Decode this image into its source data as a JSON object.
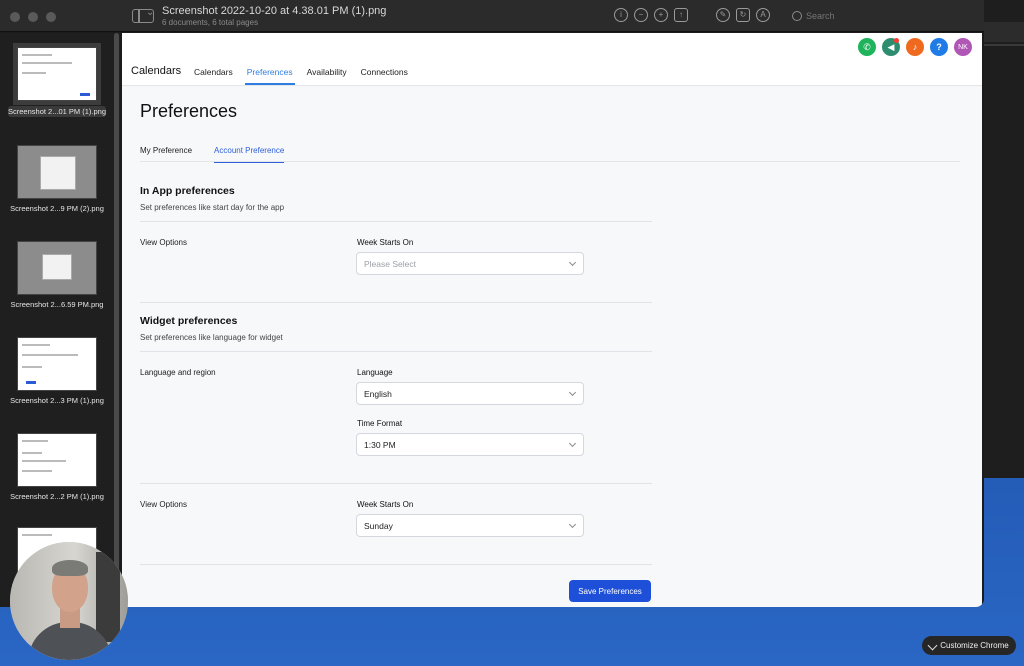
{
  "window": {
    "title": "Screenshot 2022-10-20 at 4.38.01 PM (1).png",
    "subtitle": "6 documents, 6 total pages",
    "search_placeholder": "Search"
  },
  "thumbnails": [
    {
      "caption": "Screenshot 2...01 PM (1).png",
      "selected": true
    },
    {
      "caption": "Screenshot 2...9 PM (2).png",
      "selected": false
    },
    {
      "caption": "Screenshot 2...6.59 PM.png",
      "selected": false
    },
    {
      "caption": "Screenshot 2...3 PM (1).png",
      "selected": false
    },
    {
      "caption": "Screenshot 2...2 PM (1).png",
      "selected": false
    }
  ],
  "app": {
    "brand": "Calendars",
    "nav": [
      "Calendars",
      "Preferences",
      "Availability",
      "Connections"
    ],
    "nav_active": "Preferences",
    "header_buttons": {
      "phone": "phone-icon",
      "megaphone": "megaphone-icon",
      "bell": "bell-icon",
      "help": "?",
      "avatar": "NK"
    },
    "page_title": "Preferences",
    "subtabs": [
      "My Preference",
      "Account Preference"
    ],
    "subtab_active": "Account Preference",
    "in_app": {
      "title": "In App preferences",
      "desc": "Set preferences like start day for the app",
      "row_label": "View Options",
      "week_label": "Week Starts On",
      "week_placeholder": "Please Select"
    },
    "widget": {
      "title": "Widget preferences",
      "desc": "Set preferences like language for widget",
      "lang_row_label": "Language and region",
      "language_label": "Language",
      "language_value": "English",
      "time_label": "Time Format",
      "time_value": "1:30 PM",
      "view_row_label": "View Options",
      "week_label": "Week Starts On",
      "week_value": "Sunday"
    },
    "save_label": "Save Preferences"
  },
  "chrome": {
    "customize_label": "Customize Chrome"
  },
  "colors": {
    "accent": "#1d4fd8",
    "tab_active": "#2f7de1"
  }
}
